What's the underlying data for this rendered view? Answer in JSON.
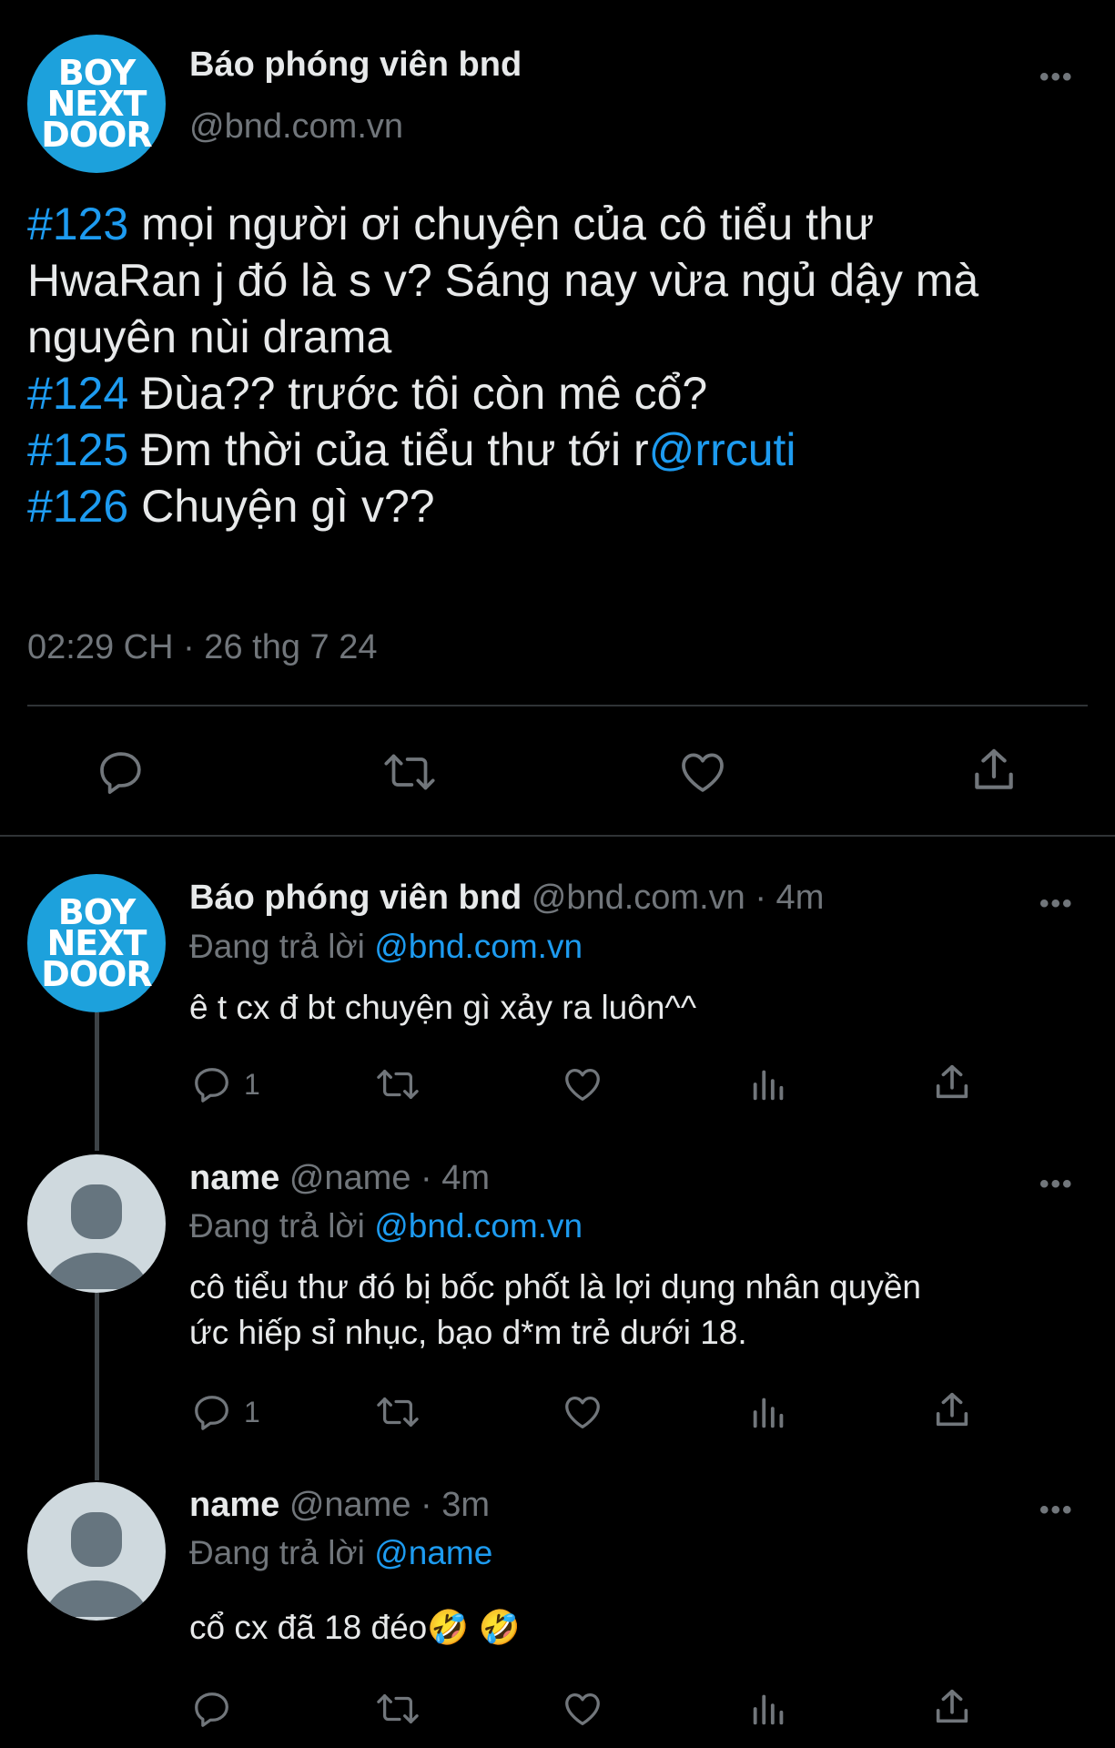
{
  "main_tweet": {
    "avatar_logo_lines": [
      "BOY",
      "NEXT",
      "DOOR"
    ],
    "display_name": "Báo phóng viên bnd",
    "handle": "@bnd.com.vn",
    "more": "•••",
    "lines": [
      {
        "tag": "#123",
        "text": " mọi người ơi chuyện của cô tiểu thư"
      },
      {
        "tag": "",
        "text": "HwaRan j đó là s v? Sáng nay vừa ngủ dậy mà"
      },
      {
        "tag": "",
        "text": "nguyên nùi drama"
      },
      {
        "tag": "#124",
        "text": " Đùa?? trước tôi còn mê cổ?"
      },
      {
        "tag": "#125",
        "text": " Đm thời của tiểu thư tới r",
        "mention": "@rrcuti"
      },
      {
        "tag": "#126",
        "text": " Chuyện gì v??"
      }
    ],
    "timestamp": "02:29 CH · 26 thg 7 24"
  },
  "replies": [
    {
      "display_name": "Báo phóng viên bnd",
      "handle": "@bnd.com.vn",
      "time": "· 4m",
      "reply_prefix": "Đang trả lời ",
      "reply_to": "@bnd.com.vn",
      "text": [
        "ê t cx đ bt chuyện gì xảy ra luôn^^"
      ],
      "reply_count": "1",
      "more": "•••"
    },
    {
      "display_name": "name",
      "handle": "@name",
      "time": "· 4m",
      "reply_prefix": "Đang trả lời ",
      "reply_to": "@bnd.com.vn",
      "text": [
        "cô tiểu thư đó bị bốc phốt là lợi dụng nhân quyền",
        "ức hiếp sỉ nhục, bạo d*m trẻ dưới 18."
      ],
      "reply_count": "1",
      "more": "•••"
    },
    {
      "display_name": "name",
      "handle": "@name",
      "time": "· 3m",
      "reply_prefix": "Đang trả lời ",
      "reply_to": "@name",
      "text": [
        "cổ cx đã 18 đéo🤣 🤣"
      ],
      "reply_count": "",
      "more": "•••"
    }
  ],
  "colors": {
    "background": "#000000",
    "text": "#e7e9ea",
    "secondary": "#71767b",
    "accent": "#1d9bf0",
    "logo_bg": "#1da1dc"
  }
}
